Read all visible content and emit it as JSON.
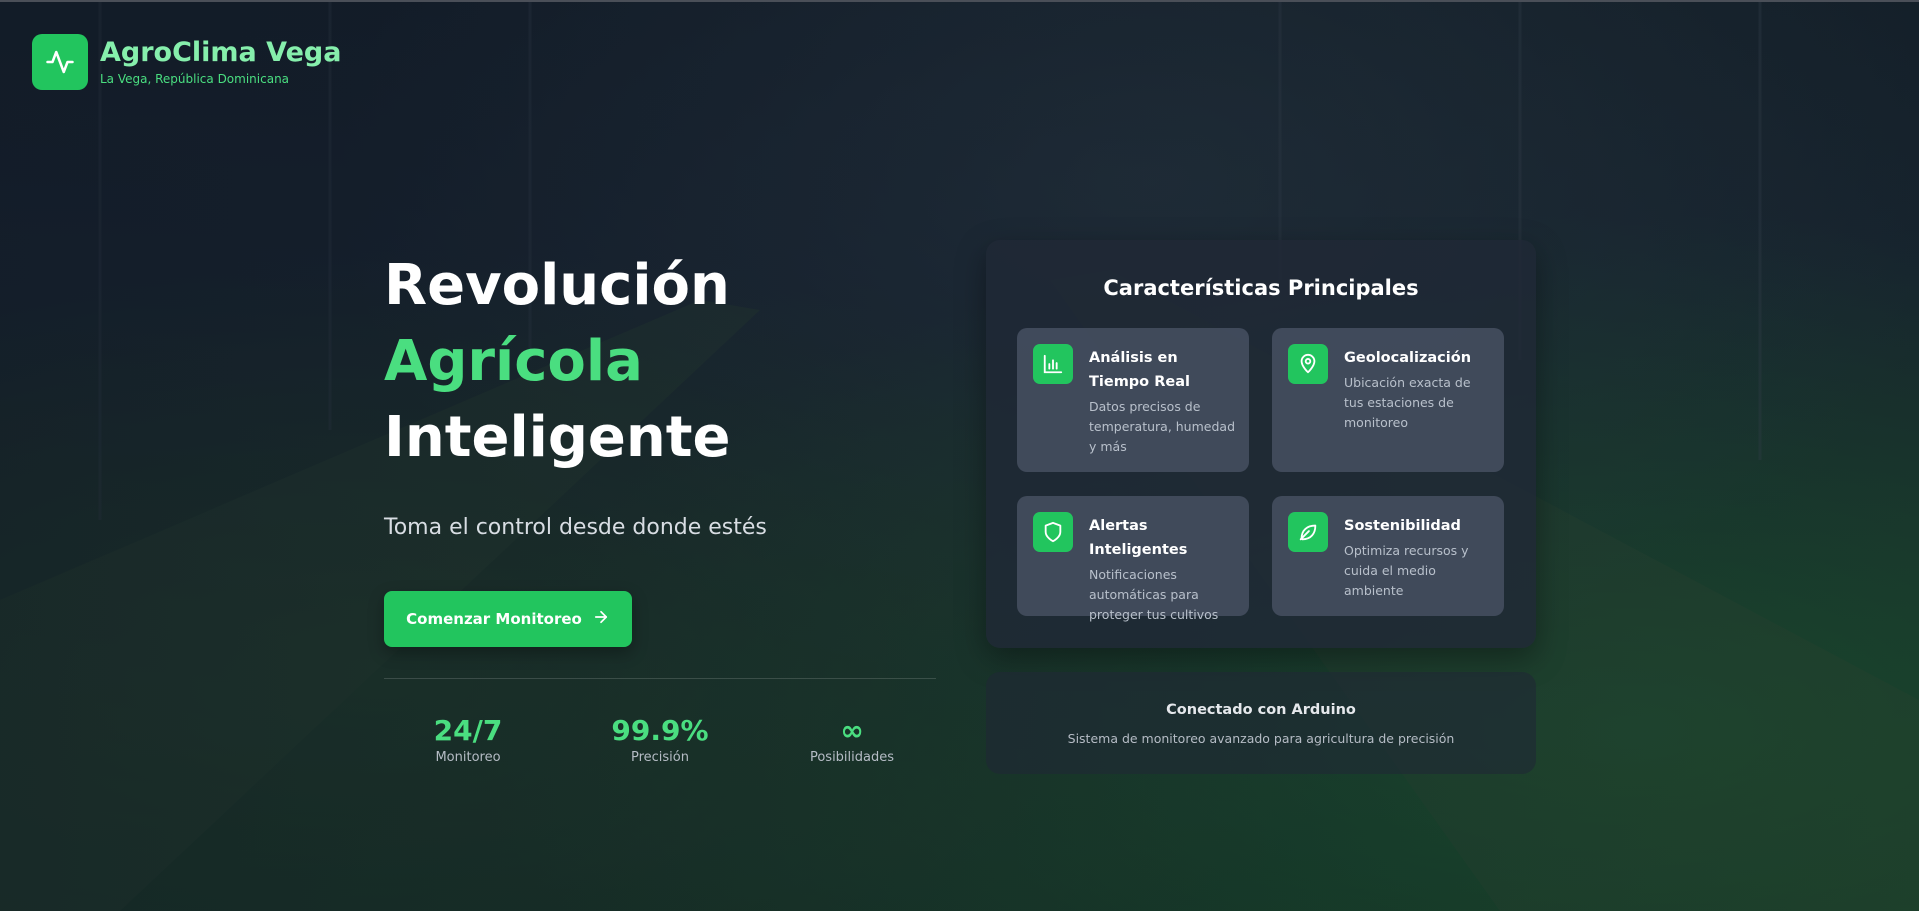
{
  "brand": {
    "title": "AgroClima Vega",
    "subtitle": "La Vega, República Dominicana",
    "icon": "activity-pulse-icon"
  },
  "hero": {
    "line1": "Revolución",
    "line2": "Agrícola",
    "line3": "Inteligente",
    "subtitle": "Toma el control desde donde estés",
    "cta_label": "Comenzar Monitoreo",
    "cta_icon": "arrow-right-icon"
  },
  "stats": [
    {
      "value": "24/7",
      "label": "Monitoreo"
    },
    {
      "value": "99.9%",
      "label": "Precisión"
    },
    {
      "value": "∞",
      "label": "Posibilidades"
    }
  ],
  "features": {
    "title": "Características Principales",
    "items": [
      {
        "title": "Análisis en Tiempo Real",
        "desc": "Datos precisos de temperatura, humedad y más",
        "icon": "bar-chart-icon"
      },
      {
        "title": "Geolocalización",
        "desc": "Ubicación exacta de tus estaciones de monitoreo",
        "icon": "map-pin-icon"
      },
      {
        "title": "Alertas Inteligentes",
        "desc": "Notificaciones automáticas para proteger tus cultivos",
        "icon": "shield-icon"
      },
      {
        "title": "Sostenibilidad",
        "desc": "Optimiza recursos y cuida el medio ambiente",
        "icon": "leaf-icon"
      }
    ]
  },
  "arduino": {
    "title": "Conectado con Arduino",
    "desc": "Sistema de monitoreo avanzado para agricultura de precisión"
  },
  "colors": {
    "accent": "#22c55e",
    "accent_light": "#4ade80",
    "brand_text": "#86efac",
    "panel": "#202836"
  }
}
